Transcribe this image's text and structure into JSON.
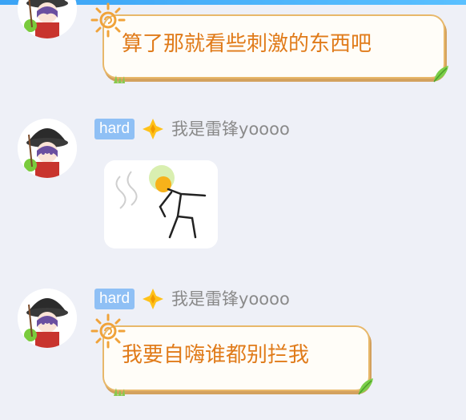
{
  "messages": [
    {
      "type": "text",
      "text": "算了那就看些刺激的东西吧"
    },
    {
      "type": "sticker",
      "badge": "hard",
      "nickname": "我是雷锋yoooo",
      "sticker_icon": "stickman-sticker"
    },
    {
      "type": "text",
      "badge": "hard",
      "nickname": "我是雷锋yoooo",
      "text": "我要自嗨谁都别拦我"
    }
  ],
  "colors": {
    "background": "#eef0f7",
    "bubble_text": "#e07b1a",
    "bubble_border": "#e8b86a",
    "badge": "#8fc0f5",
    "nickname": "#8a8a8a",
    "top_bar": "#3aa3f5"
  }
}
